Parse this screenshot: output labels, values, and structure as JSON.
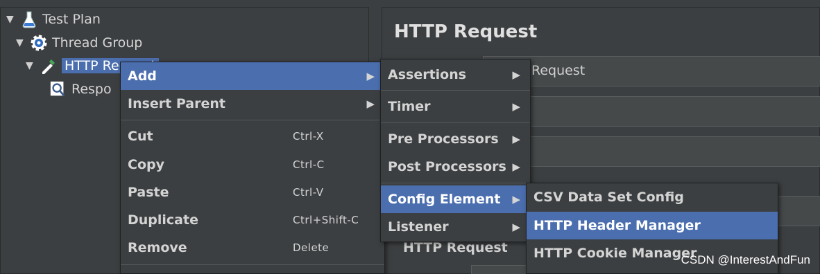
{
  "tree": {
    "items": [
      {
        "label": "Test Plan",
        "icon": "flask-icon"
      },
      {
        "label": "Thread Group",
        "icon": "gear-icon"
      },
      {
        "label": "HTTP Request",
        "icon": "pipette-icon"
      },
      {
        "label": "Respo",
        "icon": "magnifier-icon"
      }
    ],
    "arrow": "▼"
  },
  "right_panel": {
    "title": "HTTP Request",
    "name_value": "Request",
    "section_label": "HTTP Request"
  },
  "context_menu": {
    "items": [
      {
        "label": "Add",
        "submenu_arrow": "▶"
      },
      {
        "label": "Insert Parent",
        "submenu_arrow": "▶"
      },
      {
        "label": "Cut",
        "shortcut": "Ctrl-X"
      },
      {
        "label": "Copy",
        "shortcut": "Ctrl-C"
      },
      {
        "label": "Paste",
        "shortcut": "Ctrl-V"
      },
      {
        "label": "Duplicate",
        "shortcut": "Ctrl+Shift-C"
      },
      {
        "label": "Remove",
        "shortcut": "Delete"
      }
    ]
  },
  "add_submenu": {
    "items": [
      {
        "label": "Assertions",
        "submenu_arrow": "▶"
      },
      {
        "label": "Timer",
        "submenu_arrow": "▶"
      },
      {
        "label": "Pre Processors",
        "submenu_arrow": "▶"
      },
      {
        "label": "Post Processors",
        "submenu_arrow": "▶"
      },
      {
        "label": "Config Element",
        "submenu_arrow": "▶"
      },
      {
        "label": "Listener",
        "submenu_arrow": "▶"
      }
    ]
  },
  "config_submenu": {
    "items": [
      {
        "label": "CSV Data Set Config"
      },
      {
        "label": "HTTP Header Manager"
      },
      {
        "label": "HTTP Cookie Manager"
      }
    ]
  },
  "colors": {
    "selection": "#4b6eaf",
    "panel_bg": "#3c3f41"
  },
  "watermark": "CSDN @InterestAndFun"
}
